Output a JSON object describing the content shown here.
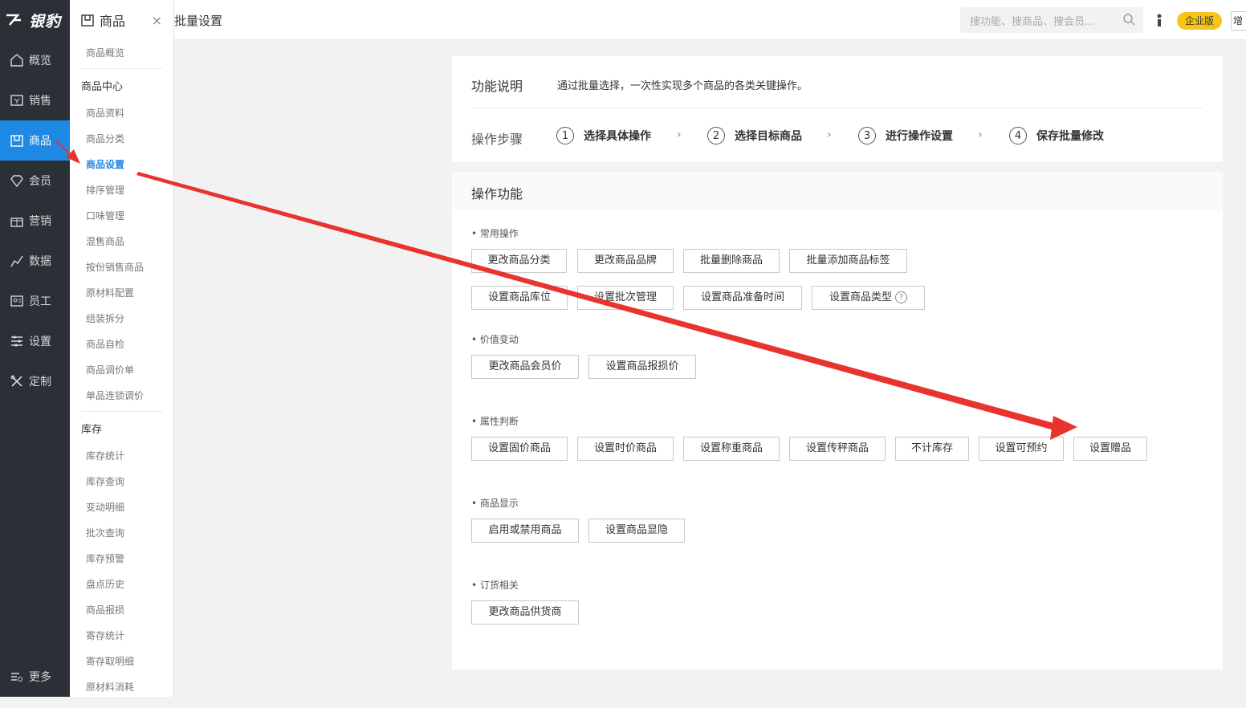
{
  "app": {
    "logo_text": "银豹",
    "accent": "#1e88e5",
    "nav_bg": "#2b2f36"
  },
  "nav": {
    "items": [
      {
        "label": "概览",
        "icon": "home-icon"
      },
      {
        "label": "销售",
        "icon": "sales-icon"
      },
      {
        "label": "商品",
        "icon": "shop-icon",
        "active": true
      },
      {
        "label": "会员",
        "icon": "diamond-icon"
      },
      {
        "label": "营销",
        "icon": "gift-icon"
      },
      {
        "label": "数据",
        "icon": "chart-icon"
      },
      {
        "label": "员工",
        "icon": "id-card-icon"
      },
      {
        "label": "设置",
        "icon": "sliders-icon"
      },
      {
        "label": "定制",
        "icon": "tools-icon"
      }
    ],
    "more_label": "更多"
  },
  "subnav": {
    "title": "商品",
    "close": "×",
    "overview": "商品概览",
    "group1_title": "商品中心",
    "group1": [
      "商品资料",
      "商品分类",
      "商品设置",
      "排序管理",
      "口味管理",
      "混售商品",
      "按份销售商品",
      "原材料配置",
      "组装拆分",
      "商品自检",
      "商品调价单",
      "单品连锁调价"
    ],
    "group2_title": "库存",
    "group2": [
      "库存统计",
      "库存查询",
      "变动明细",
      "批次查询",
      "库存预警",
      "盘点历史",
      "商品报损",
      "寄存统计",
      "寄存取明细",
      "原材料消耗"
    ]
  },
  "topbar": {
    "breadcrumb": "批量设置",
    "search_placeholder": "搜功能、搜商品、搜会员...",
    "edition_badge": "企业版",
    "edition_color": "#f5c518",
    "increment_label": "增值"
  },
  "intro": {
    "func_title": "功能说明",
    "func_desc": "通过批量选择，一次性实现多个商品的各类关键操作。",
    "steps_label": "操作步骤",
    "steps": [
      {
        "num": "1",
        "label": "选择具体操作"
      },
      {
        "num": "2",
        "label": "选择目标商品"
      },
      {
        "num": "3",
        "label": "进行操作设置"
      },
      {
        "num": "4",
        "label": "保存批量修改"
      }
    ],
    "step_sep": "›"
  },
  "ops": {
    "title": "操作功能",
    "sections": [
      {
        "title": "• 常用操作",
        "buttons": [
          "更改商品分类",
          "更改商品品牌",
          "批量删除商品",
          "批量添加商品标签",
          "设置商品库位",
          "设置批次管理",
          "设置商品准备时间",
          "设置商品类型"
        ]
      },
      {
        "title": "• 价值变动",
        "buttons": [
          "更改商品会员价",
          "设置商品报损价"
        ]
      },
      {
        "title": "• 属性判断",
        "buttons": [
          "设置固价商品",
          "设置时价商品",
          "设置称重商品",
          "设置传秤商品",
          "不计库存",
          "设置可预约",
          "设置赠品"
        ]
      },
      {
        "title": "• 商品显示",
        "buttons": [
          "启用或禁用商品",
          "设置商品显隐"
        ]
      },
      {
        "title": "• 订货相关",
        "buttons": [
          "更改商品供货商"
        ]
      }
    ],
    "help_glyph": "?"
  },
  "annotation_color": "#e8332e"
}
